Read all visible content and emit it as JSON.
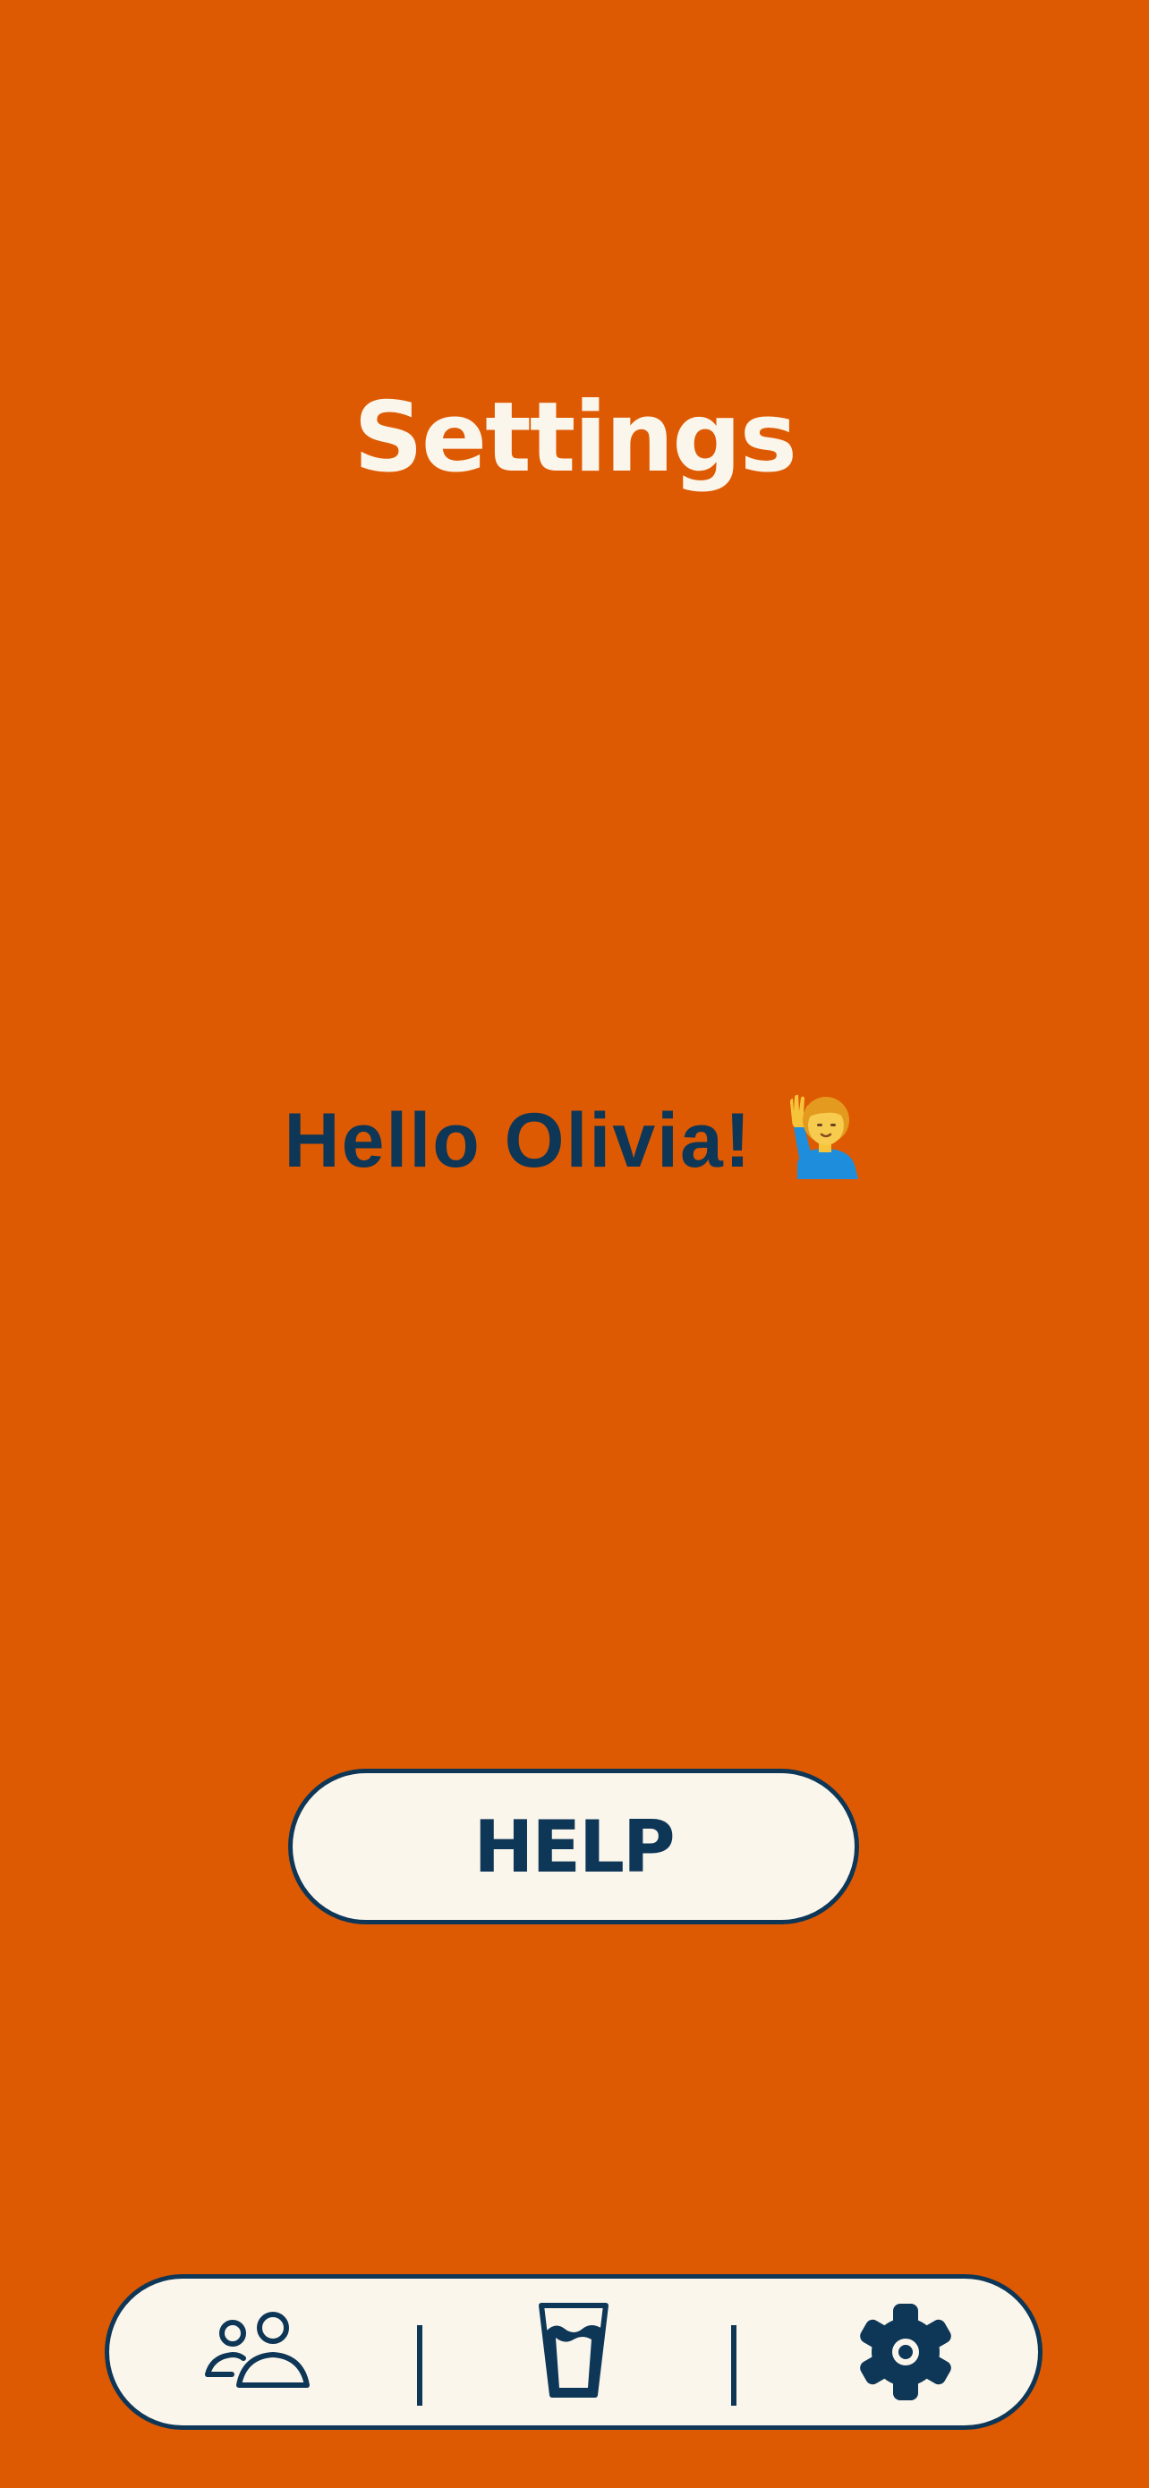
{
  "page": {
    "title": "Settings",
    "greeting": "Hello Olivia!"
  },
  "help_button": {
    "label": "HELP"
  },
  "nav": {
    "items": [
      {
        "name": "friends",
        "icon": "people-icon"
      },
      {
        "name": "drinks",
        "icon": "glass-icon"
      },
      {
        "name": "settings",
        "icon": "gear-icon",
        "active": true
      }
    ]
  },
  "colors": {
    "background": "#DE5A02",
    "ink": "#0E3656",
    "cream": "#FBF6EC"
  }
}
